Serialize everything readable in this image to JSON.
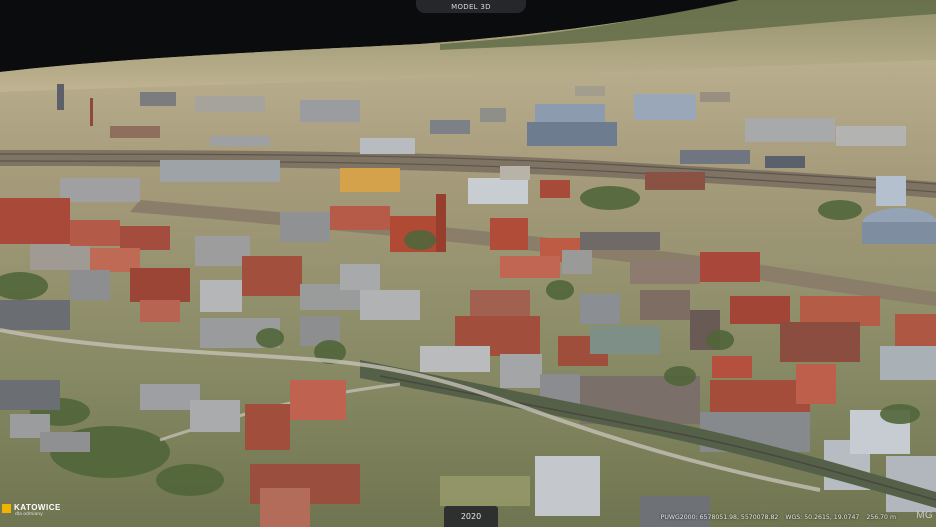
{
  "view": {
    "mode_label": "MODEL 3D",
    "year": "2020"
  },
  "city": {
    "name": "KATOWICE",
    "tagline": "dla odmiany"
  },
  "status": {
    "puwg_label": "PUWG2000:",
    "puwg_value": "6578051.98, 5570078.82",
    "wgs_label": "WGS:",
    "wgs_value": "50.2615, 19.0747",
    "height": "256.70 m"
  },
  "brand": "MG",
  "colors": {
    "sky": "#0b0c0d",
    "ground_far": "#b7ab8a",
    "ground_near": "#8e8a5e",
    "roof_red": "#a8493a",
    "roof_grey": "#8c8d8f",
    "accent": "#f0b400"
  }
}
